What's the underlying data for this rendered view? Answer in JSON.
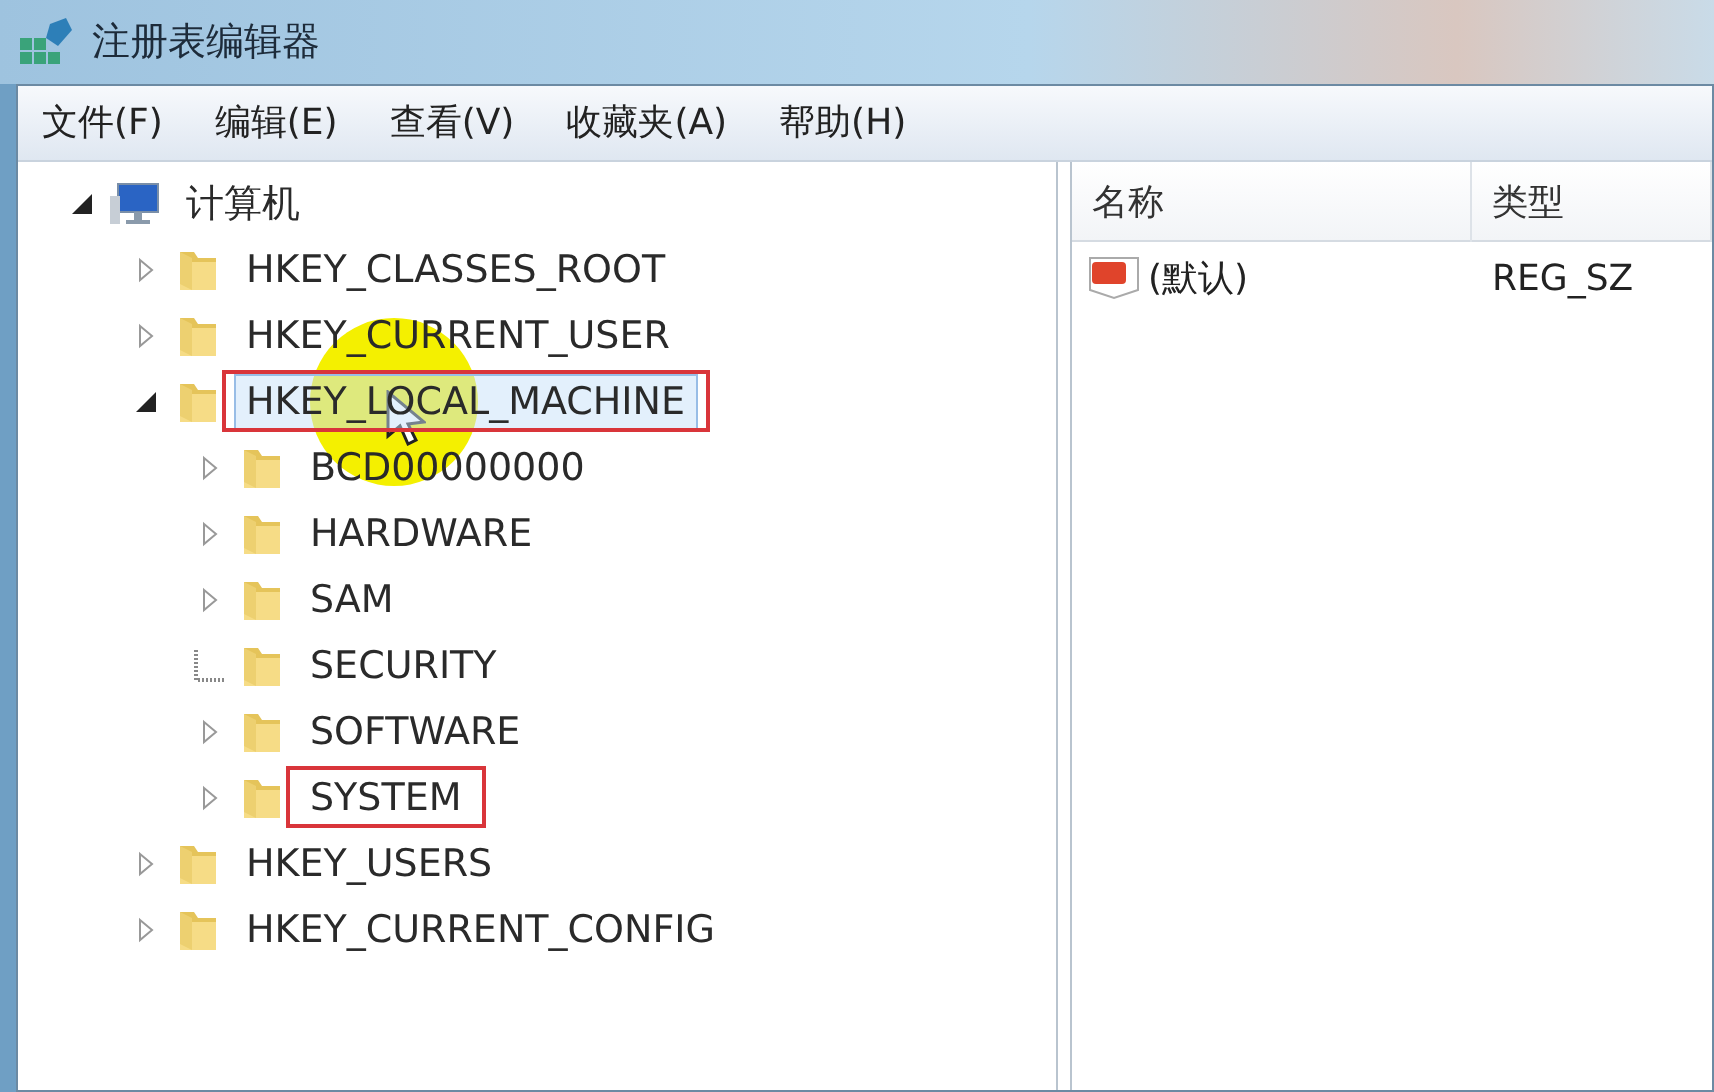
{
  "window": {
    "title": "注册表编辑器"
  },
  "menu": [
    "文件(F)",
    "编辑(E)",
    "查看(V)",
    "收藏夹(A)",
    "帮助(H)"
  ],
  "tree": {
    "label": "计算机",
    "expandable": true,
    "expanded": true,
    "children": [
      {
        "label": "HKEY_CLASSES_ROOT",
        "expandable": true,
        "expanded": false,
        "selected": false,
        "annotated": false
      },
      {
        "label": "HKEY_CURRENT_USER",
        "expandable": true,
        "expanded": false,
        "selected": false,
        "annotated": false
      },
      {
        "label": "HKEY_LOCAL_MACHINE",
        "expandable": true,
        "expanded": true,
        "selected": true,
        "annotated": true,
        "children": [
          {
            "label": "BCD00000000",
            "expandable": true,
            "expanded": false,
            "selected": false,
            "annotated": false
          },
          {
            "label": "HARDWARE",
            "expandable": true,
            "expanded": false,
            "selected": false,
            "annotated": false
          },
          {
            "label": "SAM",
            "expandable": true,
            "expanded": false,
            "selected": false,
            "annotated": false
          },
          {
            "label": "SECURITY",
            "expandable": false,
            "selected": false,
            "annotated": false
          },
          {
            "label": "SOFTWARE",
            "expandable": true,
            "expanded": false,
            "selected": false,
            "annotated": false
          },
          {
            "label": "SYSTEM",
            "expandable": true,
            "expanded": false,
            "selected": false,
            "annotated": true
          }
        ]
      },
      {
        "label": "HKEY_USERS",
        "expandable": true,
        "expanded": false,
        "selected": false,
        "annotated": false
      },
      {
        "label": "HKEY_CURRENT_CONFIG",
        "expandable": true,
        "expanded": false,
        "selected": false,
        "annotated": false
      }
    ]
  },
  "list": {
    "columns": [
      "名称",
      "类型"
    ],
    "rows": [
      {
        "name": "(默认)",
        "type": "REG_SZ"
      }
    ]
  }
}
